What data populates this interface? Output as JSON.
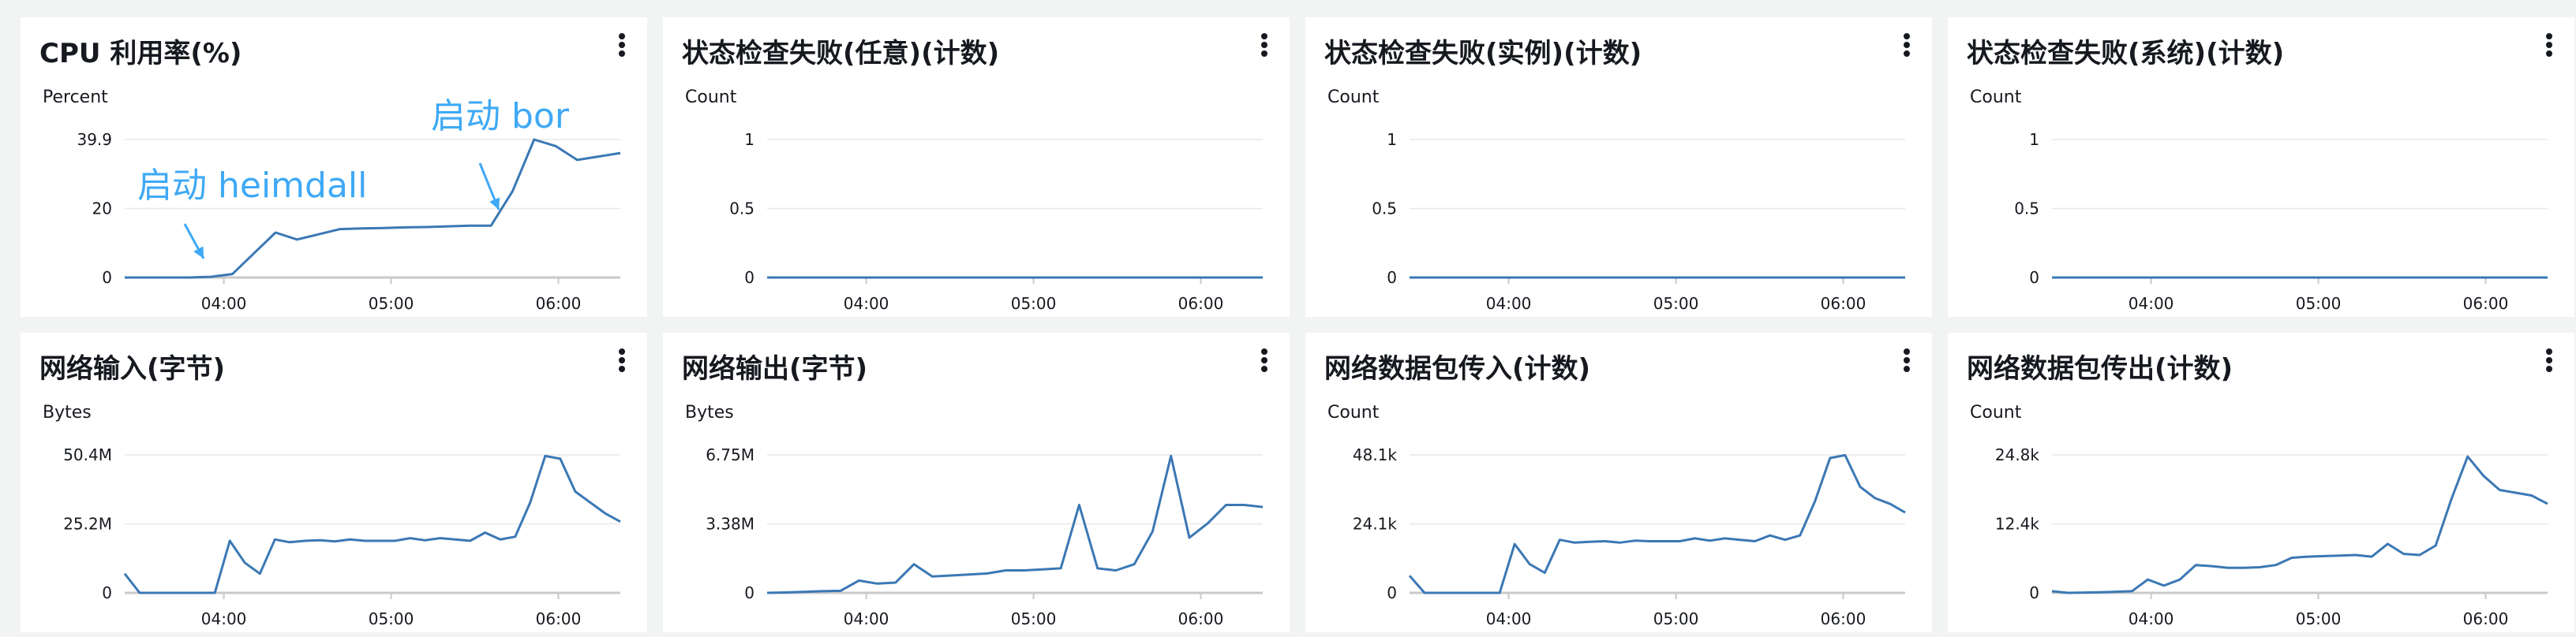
{
  "colors": {
    "series": "#3b78b4",
    "grid": "#e8e8e8",
    "axis": "#c9c9c9",
    "annotation": "#3fa9f5"
  },
  "icons": {
    "menu": "more-vertical-icon"
  },
  "chart_data": [
    {
      "type": "line",
      "title": "CPU 利用率(%)",
      "ylabel": "Percent",
      "yticks": [
        "39.9",
        "20",
        "0"
      ],
      "ylim": [
        0,
        39.9
      ],
      "xticks": [
        "04:00",
        "05:00",
        "06:00"
      ],
      "x": [
        0,
        10,
        20,
        25,
        30,
        35,
        40,
        45,
        50,
        55,
        60,
        70,
        80,
        90,
        100,
        110,
        120,
        130,
        135,
        140,
        145,
        150,
        155,
        160
      ],
      "series": [
        {
          "values": [
            0,
            0,
            0,
            0,
            0.2,
            1,
            7,
            13,
            11,
            12.5,
            14,
            14.2,
            14.3,
            14.5,
            14.6,
            14.8,
            15,
            15,
            25,
            40,
            38,
            34,
            35,
            36
          ]
        }
      ],
      "annotations": [
        "启动 heimdall",
        "启动 bor"
      ]
    },
    {
      "type": "line",
      "title": "状态检查失败(任意)(计数)",
      "ylabel": "Count",
      "yticks": [
        "1",
        "0.5",
        "0"
      ],
      "ylim": [
        0,
        1
      ],
      "xticks": [
        "04:00",
        "05:00",
        "06:00"
      ],
      "x": [
        0,
        160
      ],
      "series": [
        {
          "values": [
            0,
            0
          ]
        }
      ]
    },
    {
      "type": "line",
      "title": "状态检查失败(实例)(计数)",
      "ylabel": "Count",
      "yticks": [
        "1",
        "0.5",
        "0"
      ],
      "ylim": [
        0,
        1
      ],
      "xticks": [
        "04:00",
        "05:00",
        "06:00"
      ],
      "x": [
        0,
        160
      ],
      "series": [
        {
          "values": [
            0,
            0
          ]
        }
      ]
    },
    {
      "type": "line",
      "title": "状态检查失败(系统)(计数)",
      "ylabel": "Count",
      "yticks": [
        "1",
        "0.5",
        "0"
      ],
      "ylim": [
        0,
        1
      ],
      "xticks": [
        "04:00",
        "05:00",
        "06:00"
      ],
      "x": [
        0,
        160
      ],
      "series": [
        {
          "values": [
            0,
            0
          ]
        }
      ]
    },
    {
      "type": "line",
      "title": "网络输入(字节)",
      "ylabel": "Bytes",
      "yticks": [
        "50.4M",
        "25.2M",
        "0"
      ],
      "ylim": [
        0,
        50.4
      ],
      "xticks": [
        "04:00",
        "05:00",
        "06:00"
      ],
      "x": [
        0,
        3,
        10,
        20,
        30,
        35,
        40,
        45,
        50,
        55,
        60,
        65,
        70,
        75,
        80,
        85,
        90,
        95,
        100,
        105,
        110,
        115,
        120,
        125,
        130,
        135,
        140,
        145,
        150,
        155,
        160
      ],
      "series": [
        {
          "values": [
            7,
            0,
            0,
            0,
            0,
            0,
            0,
            19,
            11,
            7,
            19.5,
            18.5,
            19,
            19.2,
            18.8,
            19.5,
            19,
            19,
            19,
            20,
            19.2,
            20,
            19.5,
            19,
            22,
            19.5,
            20.5,
            33,
            50,
            49,
            37,
            33,
            29,
            26
          ]
        }
      ]
    },
    {
      "type": "line",
      "title": "网络输出(字节)",
      "ylabel": "Bytes",
      "yticks": [
        "6.75M",
        "3.38M",
        "0"
      ],
      "ylim": [
        0,
        6.75
      ],
      "xticks": [
        "04:00",
        "05:00",
        "06:00"
      ],
      "x": [
        0,
        10,
        20,
        30,
        35,
        40,
        45,
        50,
        55,
        60,
        65,
        70,
        75,
        80,
        85,
        90,
        95,
        100,
        105,
        110,
        115,
        120,
        125,
        130,
        135,
        140,
        145,
        150,
        155,
        160
      ],
      "series": [
        {
          "values": [
            0,
            0.02,
            0.05,
            0.08,
            0.1,
            0.6,
            0.45,
            0.5,
            1.4,
            0.8,
            0.85,
            0.9,
            0.95,
            1.1,
            1.1,
            1.15,
            1.2,
            4.3,
            1.2,
            1.1,
            1.4,
            3.0,
            6.7,
            2.7,
            3.4,
            4.3,
            4.3,
            4.2
          ]
        }
      ]
    },
    {
      "type": "line",
      "title": "网络数据包传入(计数)",
      "ylabel": "Count",
      "yticks": [
        "48.1k",
        "24.1k",
        "0"
      ],
      "ylim": [
        0,
        48.1
      ],
      "xticks": [
        "04:00",
        "05:00",
        "06:00"
      ],
      "x": [
        0,
        3,
        10,
        20,
        30,
        35,
        40,
        45,
        50,
        55,
        60,
        65,
        70,
        75,
        80,
        85,
        90,
        95,
        100,
        105,
        110,
        115,
        120,
        125,
        130,
        135,
        140,
        145,
        150,
        155,
        160
      ],
      "series": [
        {
          "values": [
            6,
            0,
            0,
            0,
            0,
            0,
            0,
            17,
            10,
            7,
            18.5,
            17.5,
            17.8,
            18,
            17.5,
            18.2,
            18,
            18,
            18,
            19,
            18.2,
            19,
            18.5,
            18,
            20,
            18.5,
            20,
            32,
            47,
            48,
            37,
            33,
            31,
            28
          ]
        }
      ]
    },
    {
      "type": "line",
      "title": "网络数据包传出(计数)",
      "ylabel": "Count",
      "yticks": [
        "24.8k",
        "12.4k",
        "0"
      ],
      "ylim": [
        0,
        24.8
      ],
      "xticks": [
        "04:00",
        "05:00",
        "06:00"
      ],
      "x": [
        0,
        3,
        10,
        20,
        30,
        35,
        40,
        45,
        50,
        55,
        60,
        65,
        70,
        75,
        80,
        85,
        90,
        95,
        100,
        105,
        110,
        115,
        120,
        125,
        130,
        135,
        140,
        145,
        150,
        155,
        160
      ],
      "series": [
        {
          "values": [
            0.3,
            0,
            0.05,
            0.1,
            0.2,
            0.3,
            2.4,
            1.3,
            2.4,
            5,
            4.8,
            4.5,
            4.5,
            4.6,
            5,
            6.3,
            6.5,
            6.6,
            6.7,
            6.8,
            6.5,
            8.8,
            7,
            6.8,
            8.5,
            17,
            24.5,
            21,
            18.5,
            18,
            17.5,
            16
          ]
        }
      ]
    }
  ]
}
